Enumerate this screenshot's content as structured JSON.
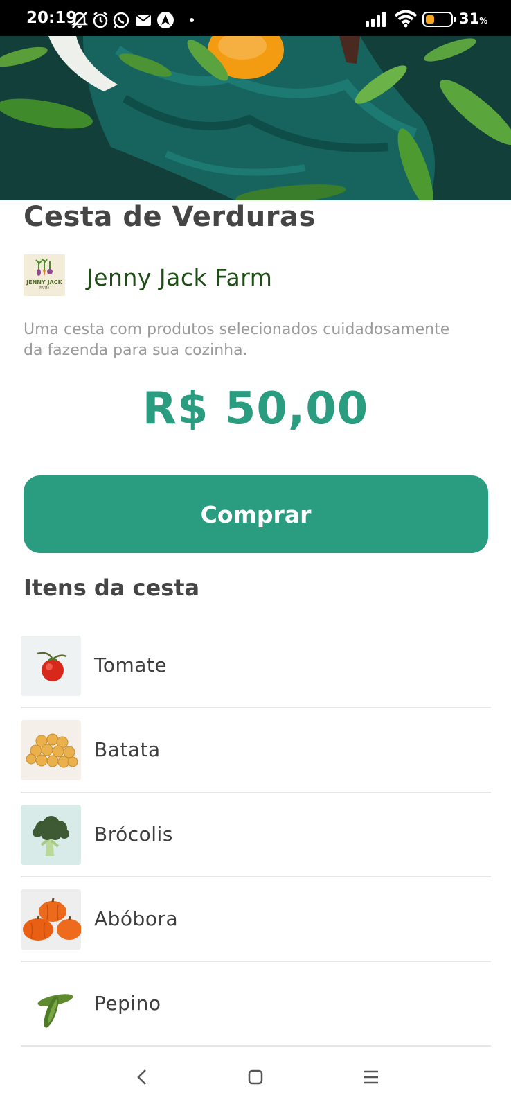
{
  "status_bar": {
    "time": "20:19",
    "battery_percent": "31",
    "battery_unit": "%",
    "icons": [
      "bell-off-icon",
      "alarm-icon",
      "whatsapp-icon",
      "mail-icon",
      "navigation-icon",
      "dot-icon",
      "signal-icon",
      "wifi-icon",
      "battery-icon"
    ]
  },
  "product": {
    "title": "Cesta de Verduras",
    "farm": {
      "name": "Jenny Jack Farm",
      "logo_text": "JENNY JACK",
      "logo_subtext": "FARM"
    },
    "description": "Uma cesta com produtos selecionados cuidadosamente da fazenda para sua cozinha.",
    "price": "R$ 50,00",
    "buy_label": "Comprar"
  },
  "basket": {
    "section_title": "Itens da cesta",
    "items": [
      {
        "label": "Tomate",
        "icon": "tomato-image"
      },
      {
        "label": "Batata",
        "icon": "potato-image"
      },
      {
        "label": "Brócolis",
        "icon": "broccoli-image"
      },
      {
        "label": "Abóbora",
        "icon": "pumpkin-image"
      },
      {
        "label": "Pepino",
        "icon": "cucumber-image"
      }
    ]
  },
  "colors": {
    "accent": "#2a9d80",
    "title": "#454545",
    "farm_name": "#1e4d16",
    "description": "#9a9a9a",
    "divider": "#e6e6e6"
  },
  "nav_bar": {
    "icons": [
      "back-icon",
      "home-icon",
      "menu-icon"
    ]
  }
}
